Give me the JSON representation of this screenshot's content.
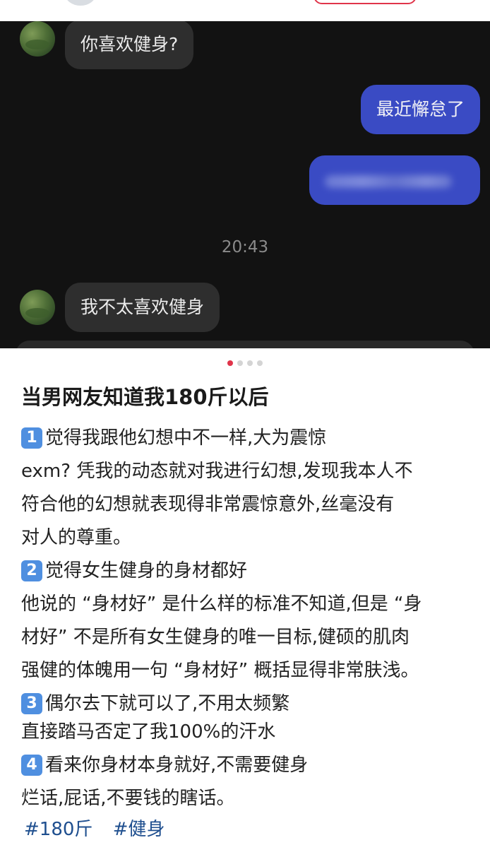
{
  "chat": {
    "messages": [
      {
        "side": "in",
        "text": "你喜欢健身?"
      },
      {
        "side": "out",
        "text": "最近懈怠了"
      },
      {
        "side": "out",
        "text": ""
      }
    ],
    "timestamp": "20:43",
    "later_message": "我不太喜欢健身"
  },
  "carousel": {
    "count": 4,
    "active_index": 0
  },
  "post": {
    "title": "当男网友知道我180斤以后",
    "points": [
      {
        "badge": "1",
        "heading": "觉得我跟他幻想中不一样,大为震惊"
      },
      {
        "badge": "2",
        "heading": "觉得女生健身的身材都好"
      },
      {
        "badge": "3",
        "heading": "偶尔去下就可以了,不用太频繁"
      },
      {
        "badge": "4",
        "heading": "看来你身材本身就好,不需要健身"
      }
    ],
    "body_lines": [
      "exm? 凭我的动态就对我进行幻想,发现我本人不",
      "符合他的幻想就表现得非常震惊意外,丝毫没有",
      "对人的尊重。",
      "他说的 “身材好” 是什么样的标准不知道,但是 “身",
      "材好” 不是所有女生健身的唯一目标,健硕的肌肉",
      "强健的体魄用一句 “身材好” 概括显得非常肤浅。",
      "直接踏马否定了我100%的汗水",
      "烂话,屁话,不要钱的瞎话。"
    ],
    "tags": [
      "#180斤",
      "#健身"
    ]
  },
  "colors": {
    "chat_background": "#121212",
    "incoming_bubble": "#2e2e2e",
    "outgoing_bubble": "#3a4bc4",
    "badge_blue": "#4f8fe0",
    "tag_blue": "#1f4f8f",
    "carousel_active_dot": "#e0344a"
  }
}
